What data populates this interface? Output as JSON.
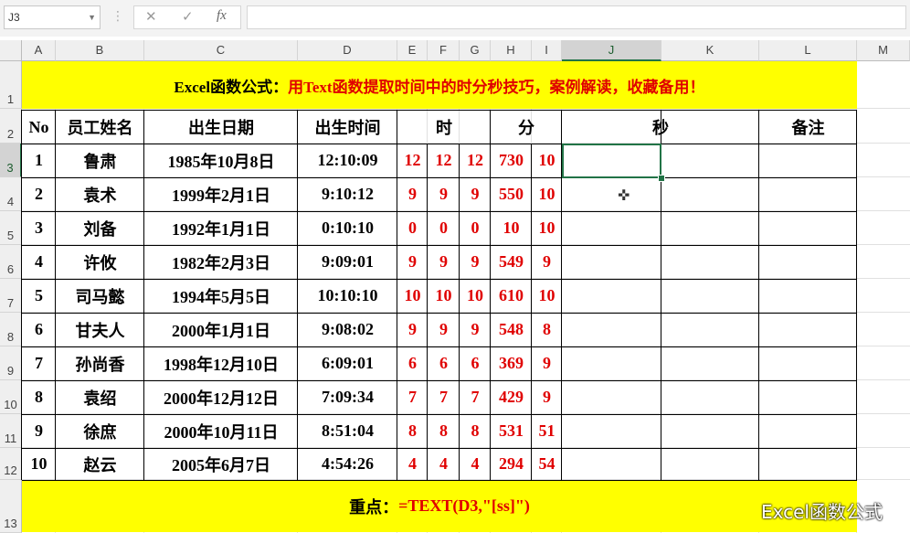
{
  "name_box": "J3",
  "formula_icons": [
    "close-icon",
    "check-icon",
    "fx-icon"
  ],
  "fx_label": "fx",
  "columns": [
    "A",
    "B",
    "C",
    "D",
    "E",
    "F",
    "G",
    "H",
    "I",
    "J",
    "K",
    "L",
    "M"
  ],
  "rows": [
    "1",
    "2",
    "3",
    "4",
    "5",
    "6",
    "7",
    "8",
    "9",
    "10",
    "11",
    "12",
    "13"
  ],
  "title": {
    "black_part": "Excel函数公式：",
    "red_part": "用Text函数提取时间中的时分秒技巧，案例解读，收藏备用！"
  },
  "headers": {
    "no": "No",
    "name": "员工姓名",
    "birth_date": "出生日期",
    "birth_time": "出生时间",
    "hour": "时",
    "minute": "分",
    "second": "秒",
    "note": "备注"
  },
  "records": [
    {
      "no": "1",
      "name": "鲁肃",
      "date": "1985年10月8日",
      "time": "12:10:09",
      "e": "12",
      "f": "12",
      "g": "12",
      "h": "730",
      "i": "10"
    },
    {
      "no": "2",
      "name": "袁术",
      "date": "1999年2月1日",
      "time": "9:10:12",
      "e": "9",
      "f": "9",
      "g": "9",
      "h": "550",
      "i": "10"
    },
    {
      "no": "3",
      "name": "刘备",
      "date": "1992年1月1日",
      "time": "0:10:10",
      "e": "0",
      "f": "0",
      "g": "0",
      "h": "10",
      "i": "10"
    },
    {
      "no": "4",
      "name": "许攸",
      "date": "1982年2月3日",
      "time": "9:09:01",
      "e": "9",
      "f": "9",
      "g": "9",
      "h": "549",
      "i": "9"
    },
    {
      "no": "5",
      "name": "司马懿",
      "date": "1994年5月5日",
      "time": "10:10:10",
      "e": "10",
      "f": "10",
      "g": "10",
      "h": "610",
      "i": "10"
    },
    {
      "no": "6",
      "name": "甘夫人",
      "date": "2000年1月1日",
      "time": "9:08:02",
      "e": "9",
      "f": "9",
      "g": "9",
      "h": "548",
      "i": "8"
    },
    {
      "no": "7",
      "name": "孙尚香",
      "date": "1998年12月10日",
      "time": "6:09:01",
      "e": "6",
      "f": "6",
      "g": "6",
      "h": "369",
      "i": "9"
    },
    {
      "no": "8",
      "name": "袁绍",
      "date": "2000年12月12日",
      "time": "7:09:34",
      "e": "7",
      "f": "7",
      "g": "7",
      "h": "429",
      "i": "9"
    },
    {
      "no": "9",
      "name": "徐庶",
      "date": "2000年10月11日",
      "time": "8:51:04",
      "e": "8",
      "f": "8",
      "g": "8",
      "h": "531",
      "i": "51"
    },
    {
      "no": "10",
      "name": "赵云",
      "date": "2005年6月7日",
      "time": "4:54:26",
      "e": "4",
      "f": "4",
      "g": "4",
      "h": "294",
      "i": "54"
    }
  ],
  "footer": {
    "black_part": "重点：",
    "red_part": "=TEXT(D3,\"[ss]\")"
  },
  "watermark": "Excel函数公式",
  "colors": {
    "highlight": "#ffff00",
    "red_text": "#e00000",
    "selection": "#217346"
  }
}
